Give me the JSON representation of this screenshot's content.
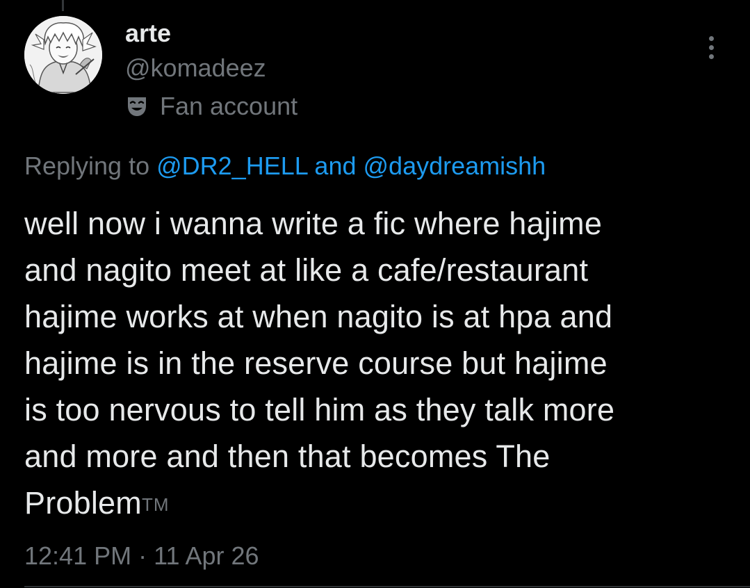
{
  "tweet": {
    "author": {
      "display_name": "arte",
      "handle": "@komadeez",
      "badge_icon": "theater-mask-icon",
      "badge_label": "Fan account",
      "avatar": "avatar"
    },
    "reply": {
      "prefix": "Replying to ",
      "mention_1": "@DR2_HELL",
      "joiner": " and ",
      "mention_2": "@daydreamishh"
    },
    "body": {
      "lines": [
        "well now i wanna write a fic where hajime",
        "and nagito meet at like a cafe/restaurant",
        "hajime works at when nagito is at hpa and",
        "hajime is in the reserve course but hajime",
        "is too nervous to tell him as they talk more",
        "and more and then that becomes The",
        "Problem"
      ],
      "trademark": "TM"
    },
    "time": "12:41 PM",
    "separator": " · ",
    "date": "11 Apr 26",
    "more_icon": "more-options-icon"
  },
  "colors": {
    "background": "#000000",
    "primary_text": "#e7e9ea",
    "secondary_text": "#71767b",
    "link": "#1d9bf0",
    "divider": "#2f3336"
  }
}
